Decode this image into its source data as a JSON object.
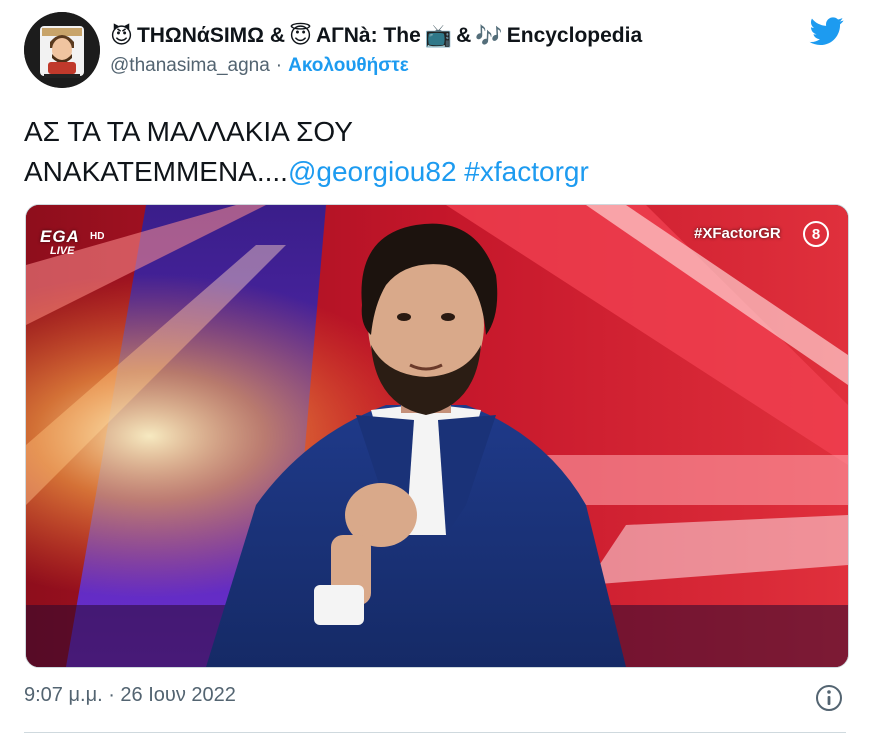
{
  "author": {
    "display_name": {
      "emoji_devil": "😈",
      "part1": "ΤΗΩΝάSΙΜΩ &",
      "emoji_halo": "😇",
      "part2": "ΑΓΝà: The",
      "emoji_tv": "📺",
      "amp": "&",
      "emoji_music": "🎶",
      "part3": "Encyclopedia"
    },
    "handle": "@thanasima_agna",
    "separator": "·",
    "follow_label": "Ακολουθήστε"
  },
  "tweet": {
    "line1": "ΑΣ ΤΑ ΤΑ ΜΑΛΛΑΚΙΑ ΣΟΥ",
    "line2_text": "ΑΝΑΚΑΤΕΜΜΕΝΑ....",
    "mention": "@georgiou82",
    "hashtag": "#xfactorgr"
  },
  "media": {
    "channel_logo": "EGA",
    "channel_hd": "HD",
    "channel_live": "LIVE",
    "hashtag_overlay": "#XFactorGR",
    "rating": "8"
  },
  "footer": {
    "timestamp": "9:07 μ.μ. · 26 Ιουν 2022"
  },
  "colors": {
    "accent": "#1d9bf0",
    "secondary_text": "#536471",
    "divider": "#cfd9de"
  },
  "icons": {
    "brand": "twitter-bird-icon",
    "info": "info-icon"
  }
}
